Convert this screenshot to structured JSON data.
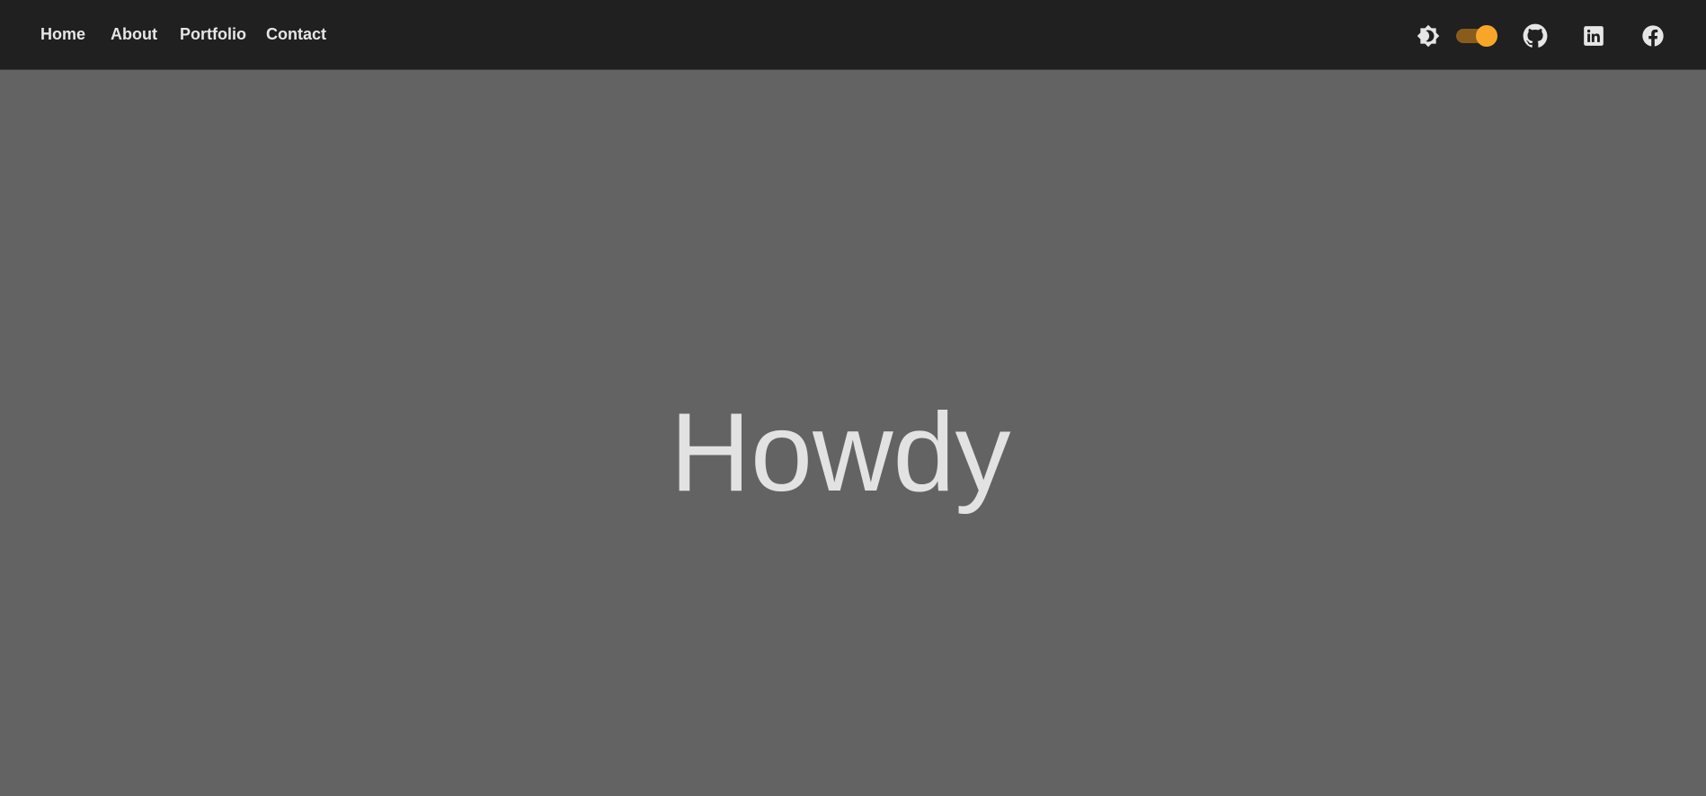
{
  "nav": {
    "links": [
      {
        "label": "Home"
      },
      {
        "label": "About"
      },
      {
        "label": "Portfolio"
      },
      {
        "label": "Contact"
      }
    ]
  },
  "toolbar": {
    "icons": [
      "brightness-icon",
      "github-icon",
      "linkedin-icon",
      "facebook-icon"
    ],
    "theme_toggle_on": true
  },
  "hero": {
    "title": "Howdy"
  },
  "colors": {
    "navbar_bg": "#202020",
    "page_bg": "#636363",
    "text": "#e6e6e6",
    "accent": "#f8a629"
  }
}
